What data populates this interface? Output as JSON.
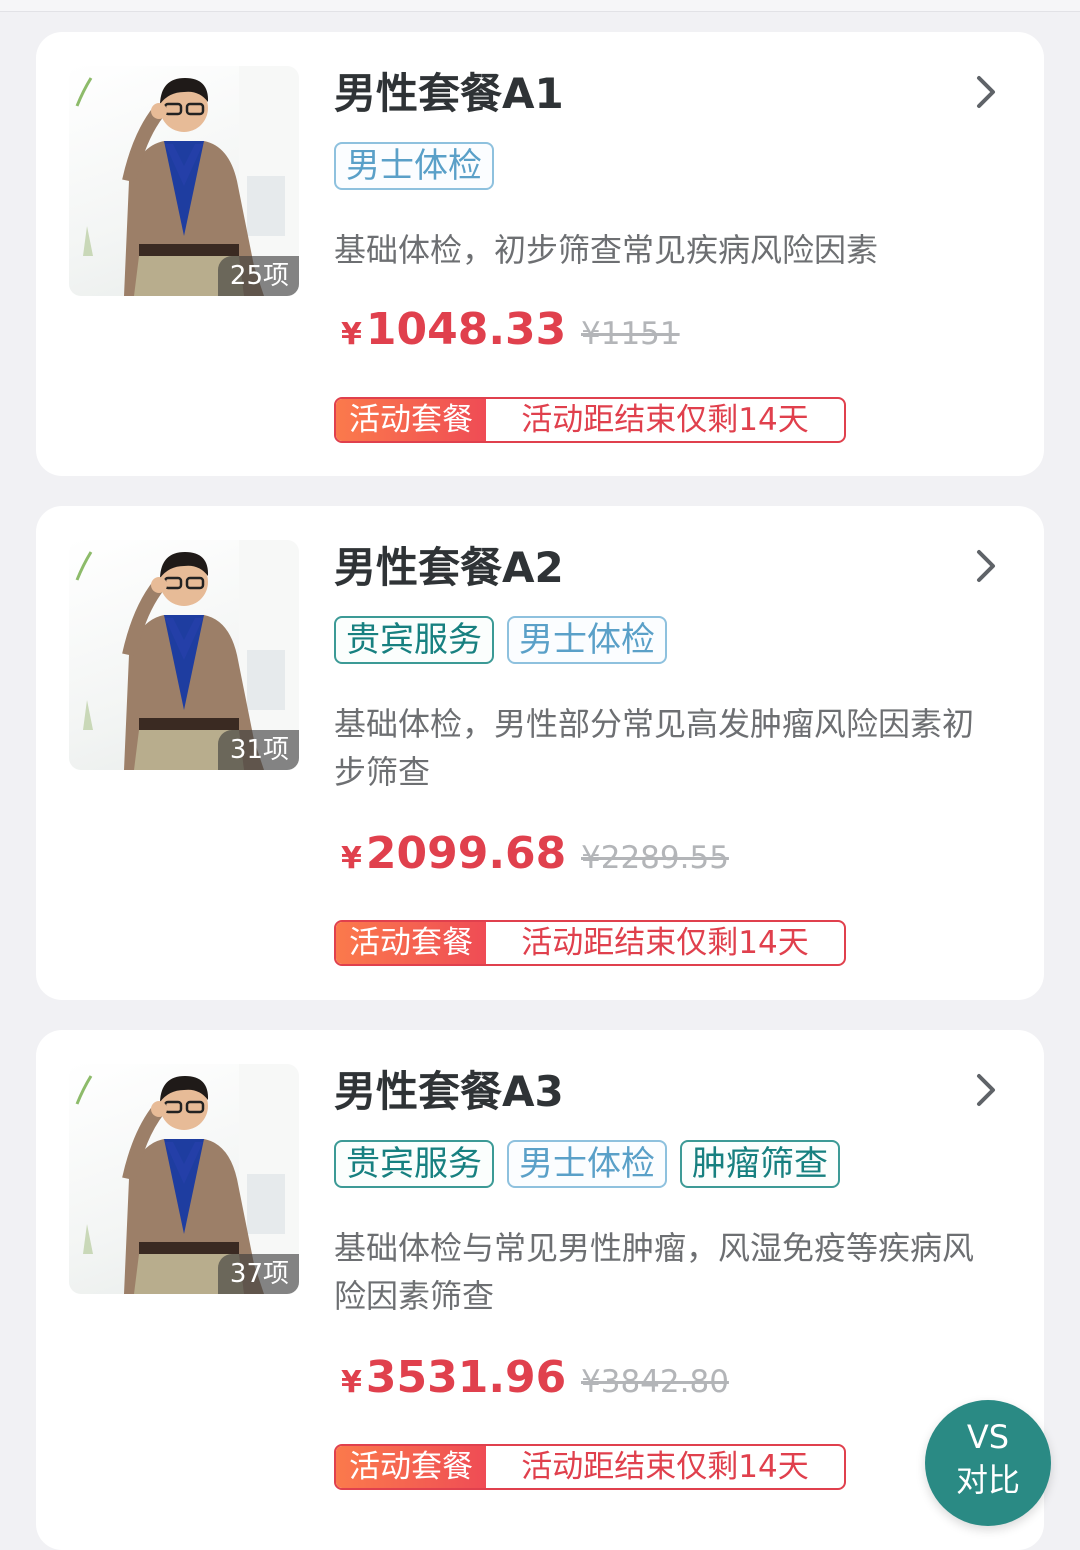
{
  "packages": [
    {
      "title": "男性套餐A1",
      "count_badge": "25项",
      "tags": [
        {
          "text": "男士体检",
          "style": "blue"
        }
      ],
      "description": "基础体检，初步筛查常见疾病风险因素",
      "currency": "¥",
      "price": "1048.33",
      "original_price": "¥1151",
      "promo_label": "活动套餐",
      "promo_text": "活动距结束仅剩14天"
    },
    {
      "title": "男性套餐A2",
      "count_badge": "31项",
      "tags": [
        {
          "text": "贵宾服务",
          "style": "green"
        },
        {
          "text": "男士体检",
          "style": "blue"
        }
      ],
      "description": "基础体检，男性部分常见高发肿瘤风险因素初步筛查",
      "currency": "¥",
      "price": "2099.68",
      "original_price": "¥2289.55",
      "promo_label": "活动套餐",
      "promo_text": "活动距结束仅剩14天"
    },
    {
      "title": "男性套餐A3",
      "count_badge": "37项",
      "tags": [
        {
          "text": "贵宾服务",
          "style": "green"
        },
        {
          "text": "男士体检",
          "style": "blue"
        },
        {
          "text": "肿瘤筛查",
          "style": "green"
        }
      ],
      "description": "基础体检与常见男性肿瘤，风湿免疫等疾病风险因素筛查",
      "currency": "¥",
      "price": "3531.96",
      "original_price": "¥3842.80",
      "promo_label": "活动套餐",
      "promo_text": "活动距结束仅剩14天"
    }
  ],
  "compare_button": {
    "line1": "VS",
    "line2": "对比"
  },
  "icons": {
    "chevron": "chevron-right-icon"
  },
  "colors": {
    "price": "#e0404d",
    "accent_teal": "#2a8a84",
    "tag_blue": "#5aa0c8"
  }
}
